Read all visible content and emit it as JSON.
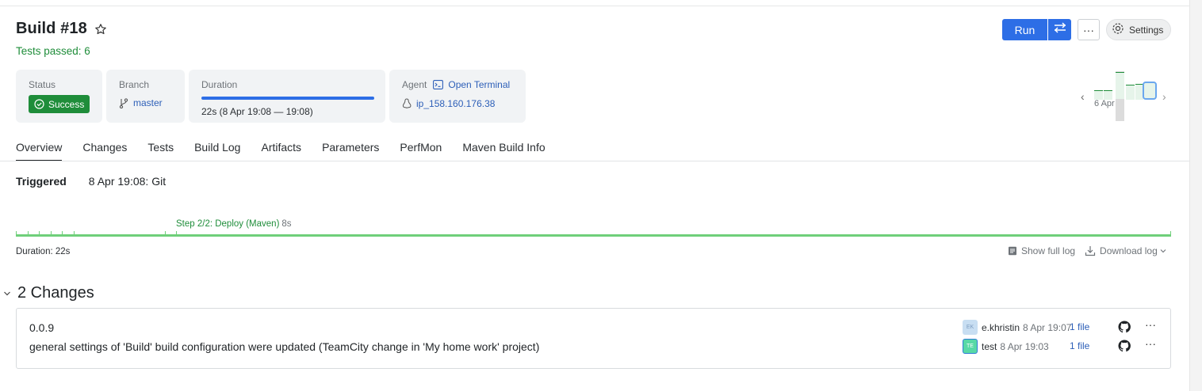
{
  "build": {
    "title": "Build #18",
    "tests_passed": "Tests passed: 6"
  },
  "toolbar": {
    "run_label": "Run",
    "more_label": "···",
    "settings_label": "Settings"
  },
  "cards": {
    "status_label": "Status",
    "status_value": "Success",
    "branch_label": "Branch",
    "branch_value": "master",
    "duration_label": "Duration",
    "duration_value": "22s (8 Apr 19:08 — 19:08)",
    "duration_progress": 1.0,
    "agent_label": "Agent",
    "agent_terminal": "Open Terminal",
    "agent_name": "ip_158.160.176.38"
  },
  "history": {
    "date_label": "6 Apr",
    "prev": "‹",
    "next": "›"
  },
  "tabs": [
    "Overview",
    "Changes",
    "Tests",
    "Build Log",
    "Artifacts",
    "Parameters",
    "PerfMon",
    "Maven Build Info"
  ],
  "triggered": {
    "label": "Triggered",
    "value": "8 Apr 19:08: Git"
  },
  "timeline": {
    "step_label": "Step 2/2: Deploy (Maven)",
    "step_duration": "8s",
    "duration": "Duration: 22s",
    "show_full_log": "Show full log",
    "download_log": "Download log"
  },
  "changes": {
    "heading": "2 Changes",
    "items": [
      {
        "title": "0.0.9",
        "avatar": "EK",
        "author": "e.khristin",
        "date": "8 Apr 19:07",
        "files": "1 file"
      },
      {
        "title": "general settings of 'Build' build configuration were updated (TeamCity change in 'My home work' project)",
        "avatar": "TE",
        "author": "test",
        "date": "8 Apr 19:03",
        "files": "1 file"
      }
    ]
  },
  "colors": {
    "accent": "#2d6ee6",
    "success": "#1f8d3a",
    "link": "#2d5fb8"
  }
}
